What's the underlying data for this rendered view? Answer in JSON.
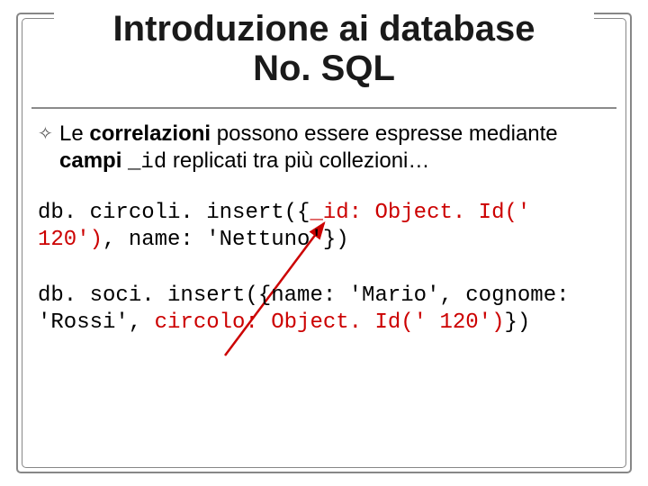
{
  "title_line1": "Introduzione ai database",
  "title_line2": "No. SQL",
  "bullet": {
    "pre": "Le ",
    "bold1": "correlazioni",
    "mid": " possono essere espresse mediante ",
    "bold2": "campi ",
    "code": "_id",
    "post": " replicati tra più collezioni…"
  },
  "code1": {
    "a": "db. circoli. insert({",
    "b": "_id: Object. Id(' 120')",
    "c": ", name: 'Nettuno'})"
  },
  "code2": {
    "a": "db. soci. insert({name: 'Mario', cognome: 'Rossi', ",
    "b": "circolo: Object. Id(' 120')",
    "c": "})"
  },
  "colors": {
    "highlight": "#cc0000",
    "frame": "#878787"
  }
}
